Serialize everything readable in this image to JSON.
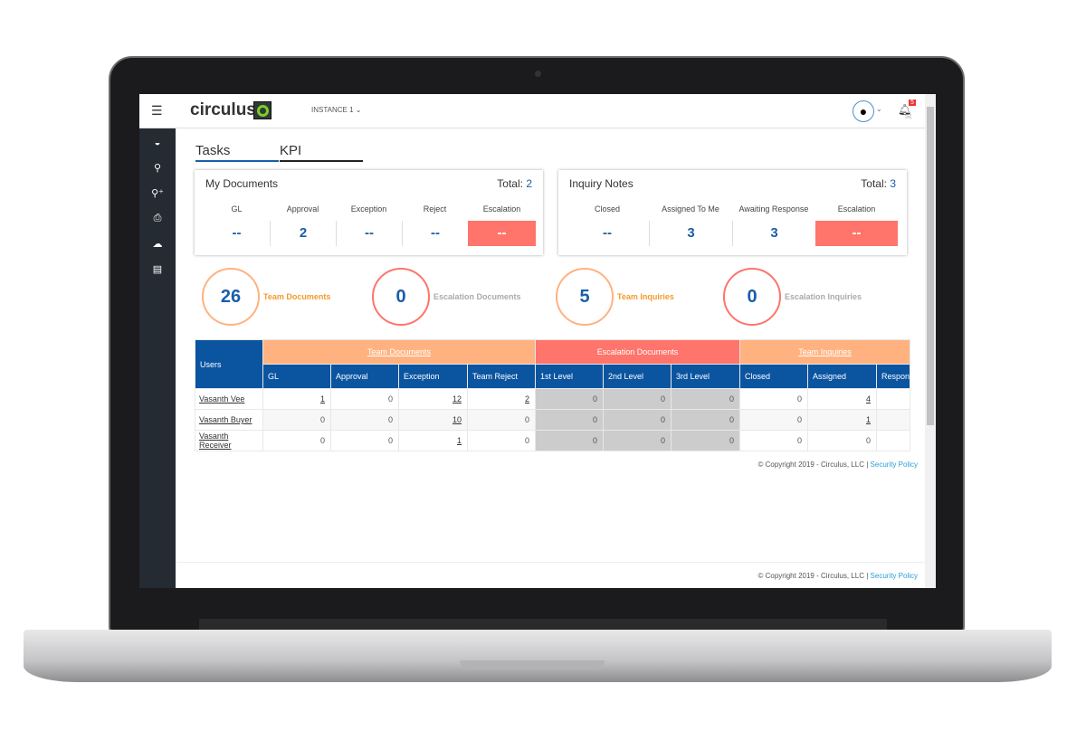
{
  "header": {
    "logo": "circulus",
    "instance": "INSTANCE 1",
    "notification_count": "5"
  },
  "sidebar": {
    "items": [
      "dashboard-icon",
      "search-icon",
      "advanced-search-icon",
      "print-icon",
      "upload-icon",
      "document-icon"
    ]
  },
  "tabs": [
    {
      "label": "Tasks",
      "active": true
    },
    {
      "label": "KPI",
      "active": false
    }
  ],
  "my_documents": {
    "title": "My Documents",
    "total_label": "Total:",
    "total": "2",
    "cells": [
      {
        "label": "GL",
        "value": "--"
      },
      {
        "label": "Approval",
        "value": "2"
      },
      {
        "label": "Exception",
        "value": "--"
      },
      {
        "label": "Reject",
        "value": "--"
      },
      {
        "label": "Escalation",
        "value": "--"
      }
    ]
  },
  "inquiry_notes": {
    "title": "Inquiry Notes",
    "total_label": "Total:",
    "total": "3",
    "cells": [
      {
        "label": "Closed",
        "value": "--"
      },
      {
        "label": "Assigned To Me",
        "value": "3"
      },
      {
        "label": "Awaiting Response",
        "value": "3"
      },
      {
        "label": "Escalation",
        "value": "--"
      }
    ]
  },
  "summary": [
    {
      "value": "26",
      "label": "Team Documents"
    },
    {
      "value": "0",
      "label": "Escalation Documents"
    },
    {
      "value": "5",
      "label": "Team Inquiries"
    },
    {
      "value": "0",
      "label": "Escalation Inquiries"
    }
  ],
  "table": {
    "groups": [
      "Team Documents",
      "Escalation Documents",
      "Team Inquiries"
    ],
    "users_header": "Users",
    "columns": [
      "GL",
      "Approval",
      "Exception",
      "Team Reject",
      "1st Level",
      "2nd Level",
      "3rd Level",
      "Closed",
      "Assigned",
      "Respon"
    ],
    "rows": [
      {
        "user": "Vasanth Vee",
        "values": [
          "1",
          "0",
          "12",
          "2",
          "0",
          "0",
          "0",
          "0",
          "4",
          ""
        ]
      },
      {
        "user": "Vasanth Buyer",
        "values": [
          "0",
          "0",
          "10",
          "0",
          "0",
          "0",
          "0",
          "0",
          "1",
          ""
        ]
      },
      {
        "user": "Vasanth Receiver",
        "values": [
          "0",
          "0",
          "1",
          "0",
          "0",
          "0",
          "0",
          "0",
          "0",
          ""
        ]
      }
    ]
  },
  "footer": {
    "copyright": "© Copyright 2019 - Circulus, LLC |",
    "link": "Security Policy"
  },
  "colors": {
    "blue": "#0b54a0",
    "orange": "#ffb27f",
    "red": "#ff746b",
    "sidebar": "#252b33"
  }
}
